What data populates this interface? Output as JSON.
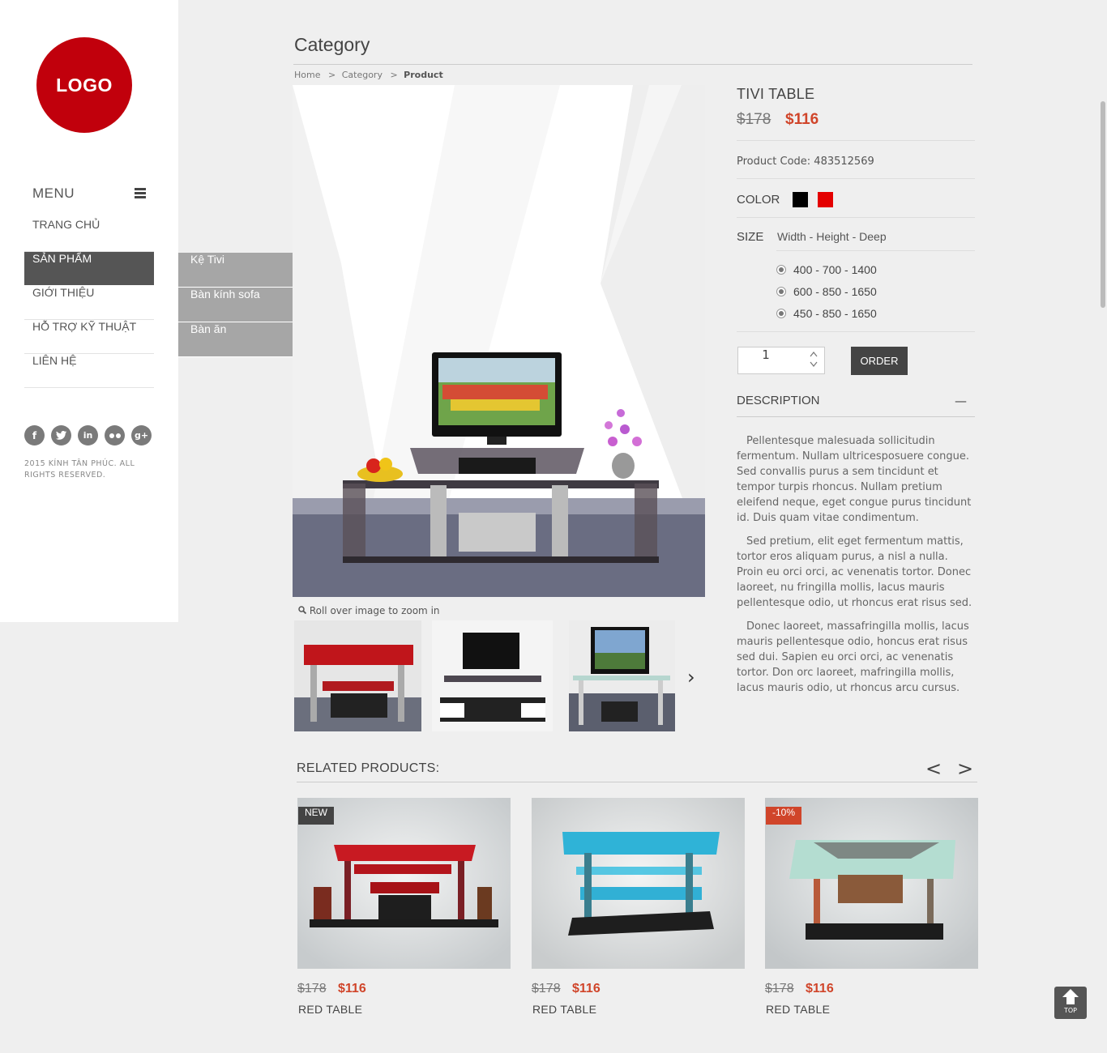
{
  "brand": {
    "logo_text": "LOGO",
    "accent": "#c1000c"
  },
  "sidebar": {
    "menu_title": "MENU",
    "items": [
      {
        "label": "TRANG CHỦ"
      },
      {
        "label": "SẢN PHẨM"
      },
      {
        "label": "GIỚI THIỆU"
      },
      {
        "label": "HỖ TRỢ KỸ THUẬT"
      },
      {
        "label": "LIÊN HỆ"
      }
    ],
    "active_index": 1,
    "social": [
      "facebook-icon",
      "twitter-icon",
      "linkedin-icon",
      "flickr-icon",
      "google-plus-icon"
    ],
    "copyright": "2015 KÍNH TÂN PHÚC. ALL RIGHTS RESERVED."
  },
  "submenu": {
    "items": [
      {
        "label": "Kệ Tivi"
      },
      {
        "label": "Bàn kính sofa"
      },
      {
        "label": "Bàn ăn"
      }
    ]
  },
  "page": {
    "title": "Category",
    "breadcrumb": [
      {
        "label": "Home"
      },
      {
        "label": "Category"
      },
      {
        "label": "Product"
      }
    ],
    "breadcrumb_sep": ">"
  },
  "gallery": {
    "zoom_hint": "Roll over image to zoom in",
    "next_label": "›"
  },
  "product": {
    "name": "TIVI TABLE",
    "old_price": "$178",
    "price": "$116",
    "code_label": "Product Code:",
    "code": "483512569",
    "color_label": "COLOR",
    "colors": [
      "#000000",
      "#e40000"
    ],
    "size_label": "SIZE",
    "size_dims": "Width - Height - Deep",
    "sizes": [
      {
        "label": "400 - 700 - 1400"
      },
      {
        "label": "600 - 850 - 1650"
      },
      {
        "label": "450 - 850 - 1650"
      }
    ],
    "quantity": "1",
    "order_label": "ORDER",
    "description_title": "DESCRIPTION",
    "description_toggle": "—",
    "description": [
      "Pellentesque malesuada sollicitudin fermentum. Nullam ultricesposuere congue. Sed convallis purus a sem tincidunt et tempor turpis rhoncus. Nullam pretium eleifend neque, eget congue purus tincidunt id. Duis quam vitae condimentum.",
      "Sed pretium, elit eget fermentum mattis, tortor eros aliquam purus, a nisl a nulla. Proin eu orci orci, ac venenatis tortor. Donec laoreet, nu fringilla mollis, lacus mauris pellentesque odio, ut rhoncus erat risus sed.",
      "Donec laoreet, massafringilla mollis, lacus mauris pellentesque odio, honcus erat risus sed dui. Sapien eu orci orci, ac venenatis tortor. Don orc laoreet, mafringilla mollis, lacus mauris odio, ut rhoncus arcu cursus."
    ]
  },
  "related": {
    "title": "RELATED PRODUCTS:",
    "prev_label": "<",
    "next_label": ">",
    "items": [
      {
        "badge": "NEW",
        "badge_color": "#444444",
        "old_price": "$178",
        "price": "$116",
        "name": "RED TABLE"
      },
      {
        "badge": "",
        "badge_color": "",
        "old_price": "$178",
        "price": "$116",
        "name": "RED TABLE"
      },
      {
        "badge": "-10%",
        "badge_color": "#d0452a",
        "old_price": "$178",
        "price": "$116",
        "name": "RED TABLE"
      }
    ]
  },
  "top_button": {
    "label": "TOP"
  }
}
